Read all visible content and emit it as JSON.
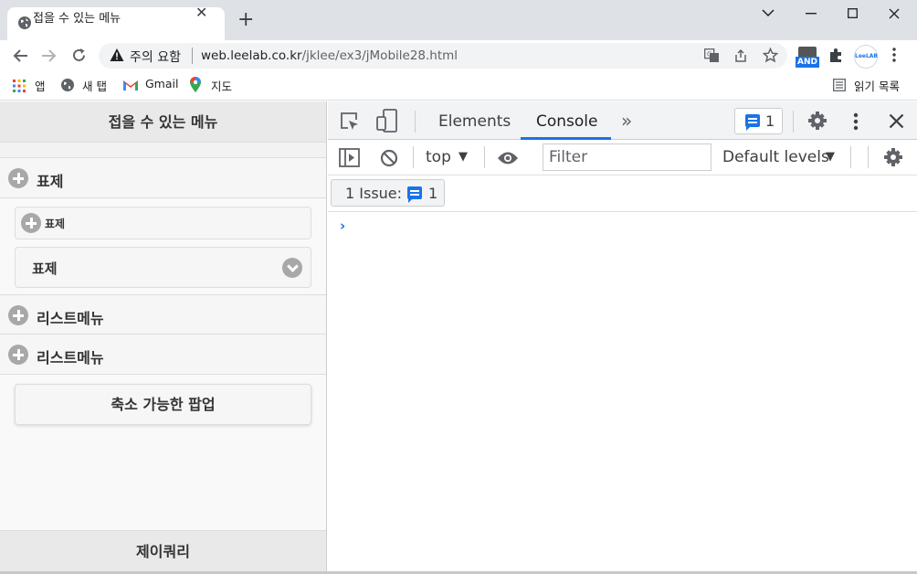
{
  "browser": {
    "tab_title": "접을 수 있는 메뉴",
    "omnibox": {
      "security_note": "주의 요함",
      "url_host": "web.leelab.co.kr",
      "url_path": "/jklee/ex3/jMobile28.html"
    },
    "extensions": {
      "and_label": "AND",
      "leelab_label": "LeeLAB"
    },
    "bookmarks": [
      {
        "label": "앱",
        "icon": "apps-grid-icon"
      },
      {
        "label": "새 탭",
        "icon": "globe-icon"
      },
      {
        "label": "Gmail",
        "icon": "gmail-icon"
      },
      {
        "label": "지도",
        "icon": "maps-pin-icon"
      }
    ],
    "reading_list": "읽기 목록"
  },
  "page": {
    "header_title": "접을 수 있는 메뉴",
    "collapsible_1": {
      "label": "표제",
      "inner_button": "표제",
      "select_value": "표제"
    },
    "collapsible_2": {
      "label": "리스트메뉴"
    },
    "collapsible_3": {
      "label": "리스트메뉴"
    },
    "popup_button": "축소 가능한 팝업",
    "footer_title": "제이쿼리"
  },
  "devtools": {
    "tabs": [
      "Elements",
      "Console"
    ],
    "active_tab": "Console",
    "issues_badge_count": "1",
    "context": "top",
    "filter_placeholder": "Filter",
    "levels": "Default levels",
    "issues_chip_label": "1 Issue:",
    "issues_chip_count": "1",
    "prompt_symbol": "›"
  },
  "colors": {
    "accent": "#1a73e8",
    "titlebar": "#dee1e6",
    "jqm_header": "#e9e9e9"
  }
}
